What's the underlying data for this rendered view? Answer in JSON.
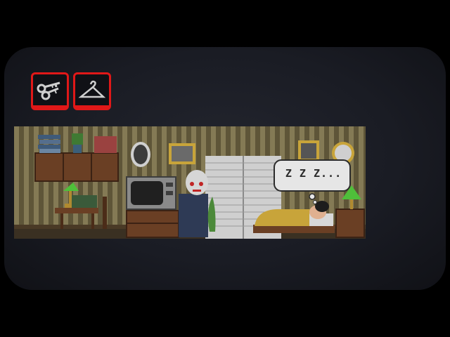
{
  "inventory": {
    "items": [
      {
        "name": "keys",
        "icon": "keys-icon"
      },
      {
        "name": "hanger",
        "icon": "hanger-icon"
      }
    ]
  },
  "scene": {
    "speech_bubble_text": "Z Z Z..."
  },
  "colors": {
    "slot_border": "#e01818",
    "background": "#000000",
    "vignette": "#1a1c24",
    "wallpaper_light": "#847a55",
    "wallpaper_dark": "#5e5538"
  }
}
